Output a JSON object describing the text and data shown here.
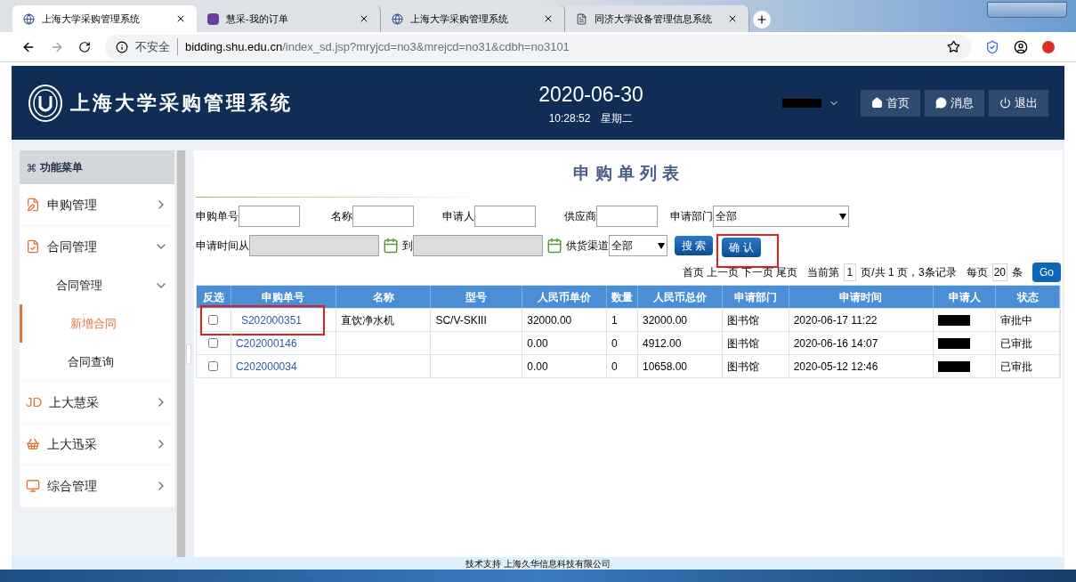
{
  "browser": {
    "tabs": [
      {
        "title": "上海大学采购管理系统",
        "selected": true
      },
      {
        "title": "慧采-我的订单",
        "selected": false
      },
      {
        "title": "上海大学采购管理系统",
        "selected": false
      },
      {
        "title": "同济大学设备管理信息系统",
        "selected": false
      }
    ],
    "security": "不安全",
    "url_host": "bidding.shu.edu.cn",
    "url_path": "/index_sd.jsp?mryjcd=no3&mrejcd=no31&cdbh=no3101"
  },
  "header": {
    "title": "上海大学采购管理系统",
    "date": "2020-06-30",
    "time": "10:28:52",
    "weekday": "星期二",
    "buttons": [
      {
        "label": "首页"
      },
      {
        "label": "消息"
      },
      {
        "label": "退出"
      }
    ]
  },
  "sidebar": {
    "title": "功能菜单",
    "items": [
      {
        "label": "申购管理",
        "expanded": false
      },
      {
        "label": "合同管理",
        "expanded": true,
        "children": [
          {
            "label": "合同管理",
            "expanded": true,
            "children": [
              {
                "label": "新增合同",
                "selected": true
              },
              {
                "label": "合同查询",
                "selected": false
              }
            ]
          }
        ]
      },
      {
        "label": "上大慧采",
        "expanded": false,
        "icon_text": "JD"
      },
      {
        "label": "上大迅采",
        "expanded": false
      },
      {
        "label": "综合管理",
        "expanded": false
      }
    ]
  },
  "page_title": "申购单列表",
  "filters": {
    "order_no": "申购单号",
    "name": "名称",
    "applicant": "申请人",
    "supplier": "供应商",
    "department": "申请部门",
    "department_value": "全部",
    "time_from": "申请时间从",
    "time_to": "到",
    "channel": "供货渠道",
    "channel_value": "全部",
    "search_button": "搜 索",
    "confirm_button": "确 认"
  },
  "pager": {
    "links": [
      "首页",
      "上一页",
      "下一页",
      "尾页"
    ],
    "current_label": "当前第",
    "current": "1",
    "total": "页/共 1 页，3条记录",
    "per_page_label": "每页",
    "per_page": "20",
    "unit": "条",
    "go": "Go"
  },
  "table": {
    "columns": [
      "反选",
      "申购单号",
      "名称",
      "型号",
      "人民币单价",
      "数量",
      "人民币总价",
      "申请部门",
      "申请时间",
      "申请人",
      "状态"
    ],
    "rows": [
      {
        "checked": false,
        "highlighted": true,
        "cells": [
          "",
          "S202000351",
          "直饮净水机",
          "SC/V-SKIII",
          "32000.00",
          "1",
          "32000.00",
          "图书馆",
          "2020-06-17 11:22",
          "",
          "审批中"
        ]
      },
      {
        "checked": false,
        "highlighted": false,
        "cells": [
          "",
          "C202000146",
          "",
          "",
          "0.00",
          "0",
          "4912.00",
          "图书馆",
          "2020-06-16 14:07",
          "",
          "已审批"
        ]
      },
      {
        "checked": false,
        "highlighted": false,
        "cells": [
          "",
          "C202000034",
          "",
          "",
          "0.00",
          "0",
          "10658.00",
          "图书馆",
          "2020-05-12 12:46",
          "",
          "已审批"
        ]
      }
    ]
  },
  "footer": "技术支持 上海久华信息科技有限公司"
}
